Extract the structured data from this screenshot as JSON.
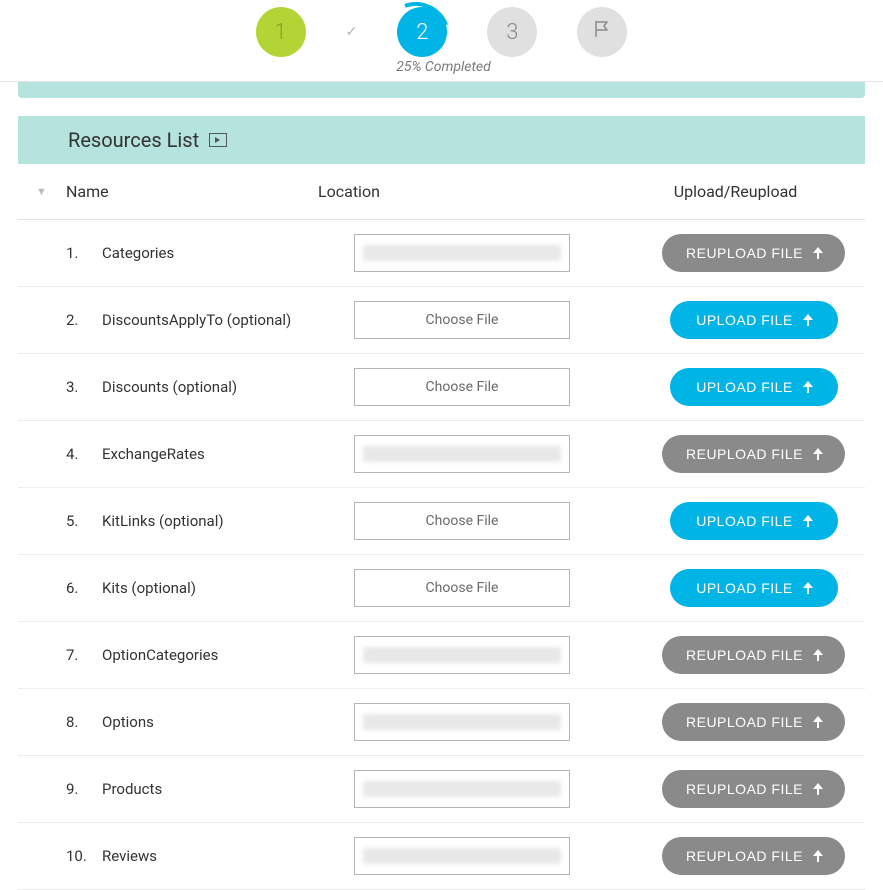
{
  "stepper": {
    "steps": [
      {
        "label": "1"
      },
      {
        "label": "2"
      },
      {
        "label": "3"
      }
    ],
    "progress_text": "25% Completed"
  },
  "section": {
    "title": "Resources List"
  },
  "table": {
    "headers": {
      "name": "Name",
      "location": "Location",
      "upload": "Upload/Reupload"
    },
    "choose_file_label": "Choose File",
    "upload_label": "UPLOAD FILE",
    "reupload_label": "REUPLOAD FILE",
    "rows": [
      {
        "num": "1.",
        "name": "Categories",
        "has_file": true
      },
      {
        "num": "2.",
        "name": "DiscountsApplyTo (optional)",
        "has_file": false
      },
      {
        "num": "3.",
        "name": "Discounts (optional)",
        "has_file": false
      },
      {
        "num": "4.",
        "name": "ExchangeRates",
        "has_file": true
      },
      {
        "num": "5.",
        "name": "KitLinks (optional)",
        "has_file": false
      },
      {
        "num": "6.",
        "name": "Kits (optional)",
        "has_file": false
      },
      {
        "num": "7.",
        "name": "OptionCategories",
        "has_file": true
      },
      {
        "num": "8.",
        "name": "Options",
        "has_file": true
      },
      {
        "num": "9.",
        "name": "Products",
        "has_file": true
      },
      {
        "num": "10.",
        "name": "Reviews",
        "has_file": true
      }
    ]
  }
}
